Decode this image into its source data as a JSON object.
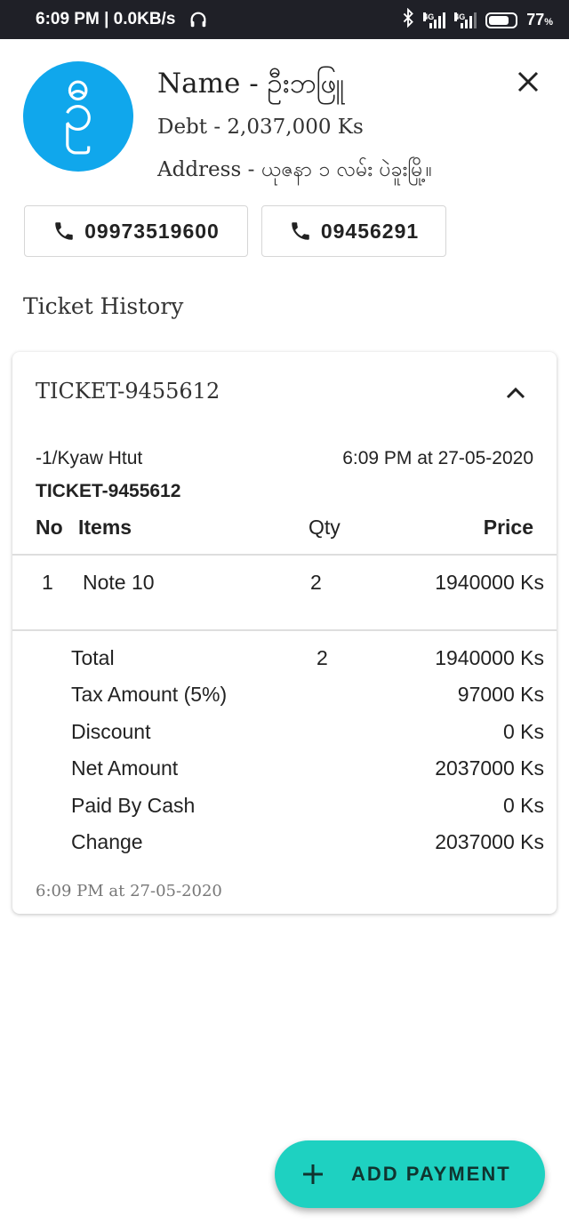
{
  "status_bar": {
    "time_speed": "6:09 PM | 0.0KB/s",
    "net1": "4G",
    "net2": "4G",
    "battery": "77",
    "battery_unit": "%",
    "battery_level": 0.77,
    "icons": [
      "headphones-icon",
      "bluetooth-icon",
      "signal-icon",
      "battery-icon"
    ]
  },
  "customer": {
    "avatar_letter": "ဦ",
    "name": "Name - ဦးဘဖြူ",
    "debt": "Debt - 2,037,000 Ks",
    "address": "Address - ယုဇနာ ၁ လမ်း ပဲခူးမြို့။",
    "phones": [
      "09973519600",
      "09456291"
    ]
  },
  "section_title": "Ticket History",
  "ticket": {
    "title": "TICKET-9455612",
    "cashier": "-1/Kyaw Htut",
    "datetime": "6:09 PM at 27-05-2020",
    "ticket_no": "TICKET-9455612",
    "headers": {
      "no": "No",
      "items": "Items",
      "qty": "Qty",
      "price": "Price"
    },
    "items": [
      {
        "no": "1",
        "name": "Note 10",
        "qty": "2",
        "price": "1940000 Ks"
      }
    ],
    "summary": [
      {
        "label": "Total",
        "qty": "2",
        "value": "1940000 Ks"
      },
      {
        "label": "Tax Amount (5%)",
        "qty": "",
        "value": "97000 Ks"
      },
      {
        "label": "Discount",
        "qty": "",
        "value": "0 Ks"
      },
      {
        "label": "Net Amount",
        "qty": "",
        "value": "2037000 Ks"
      },
      {
        "label": "Paid By Cash",
        "qty": "",
        "value": "0 Ks"
      },
      {
        "label": "Change",
        "qty": "",
        "value": "2037000 Ks"
      }
    ],
    "footer_date": "6:09 PM at 27-05-2020"
  },
  "fab": {
    "label": "ADD PAYMENT",
    "icon": "plus-icon"
  },
  "colors": {
    "avatar": "#10a7ec",
    "fab": "#1ed1c1",
    "status_bar": "#1f2027"
  }
}
